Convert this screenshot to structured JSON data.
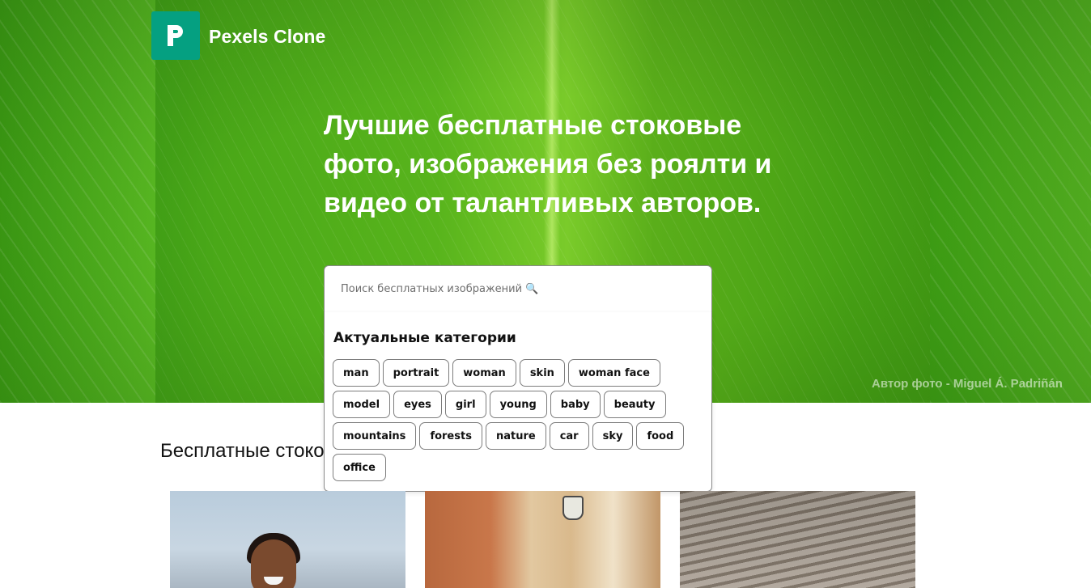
{
  "brand": {
    "logo_letter": "P",
    "name": "Pexels Clone",
    "color": "#05a081"
  },
  "hero": {
    "headline": "Лучшие бесплатные стоковые фото, изображения без роялти и видео от талантливых авторов.",
    "credit": "Автор фото - Miguel Á. Padriñán"
  },
  "search": {
    "placeholder": "Поиск бесплатных изображений 🔍",
    "value": ""
  },
  "dropdown": {
    "title": "Актуальные категории",
    "tags": [
      "man",
      "portrait",
      "woman",
      "skin",
      "woman face",
      "model",
      "eyes",
      "girl",
      "young",
      "baby",
      "beauty",
      "mountains",
      "forests",
      "nature",
      "car",
      "sky",
      "food",
      "office"
    ]
  },
  "main": {
    "section_title": "Бесплатные стоковые фото"
  }
}
